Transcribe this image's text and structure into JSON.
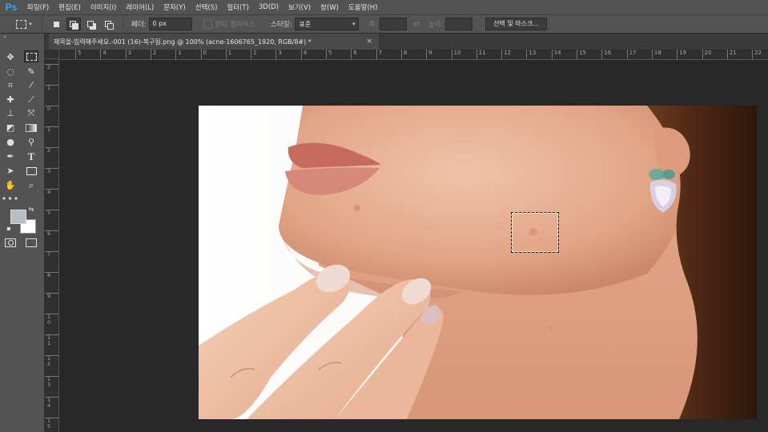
{
  "app": {
    "logo": "Ps"
  },
  "menu": [
    "파일(F)",
    "편집(E)",
    "이미지(I)",
    "레이어(L)",
    "문자(Y)",
    "선택(S)",
    "필터(T)",
    "3D(D)",
    "보기(V)",
    "창(W)",
    "도움말(H)"
  ],
  "options": {
    "feather_label": "페더:",
    "feather_value": "0 px",
    "antialias_label": "앤티 앨리어스",
    "style_label": "스타일:",
    "style_value": "표준",
    "width_label": "폭:",
    "height_label": "높이:",
    "select_mask_button": "선택 및 마스크..."
  },
  "document": {
    "tab_title": "제목을-입력해주세요.-001 (16)-복구됨.png @ 100% (acne-1606765_1920, RGB/8#) *",
    "close": "×"
  },
  "ruler": {
    "top": [
      "5",
      "4",
      "3",
      "2",
      "1",
      "0",
      "1",
      "2",
      "3",
      "4",
      "5",
      "6",
      "7",
      "8",
      "9",
      "10",
      "11",
      "12",
      "13",
      "14",
      "15",
      "16",
      "17",
      "18",
      "19",
      "20",
      "21",
      "22"
    ],
    "left": [
      "2",
      "1",
      "0",
      "1",
      "2",
      "3",
      "4",
      "5",
      "6",
      "7",
      "8",
      "9",
      "1 0",
      "1 1",
      "1 2",
      "1 3",
      "1 4",
      "1 5"
    ]
  },
  "tools": [
    "move-tool",
    "marquee-tool",
    "lasso-tool",
    "quick-select-tool",
    "crop-tool",
    "eyedropper-tool",
    "healing-brush-tool",
    "brush-tool",
    "clone-stamp-tool",
    "history-brush-tool",
    "eraser-tool",
    "gradient-tool",
    "blur-tool",
    "dodge-tool",
    "pen-tool",
    "type-tool",
    "path-select-tool",
    "rectangle-tool",
    "hand-tool",
    "zoom-tool",
    "more-tools",
    "quick-mask",
    "screen-mode"
  ],
  "colors": {
    "foreground": "#b8bec8",
    "background": "#ffffff",
    "accent": "#31a8ff"
  }
}
